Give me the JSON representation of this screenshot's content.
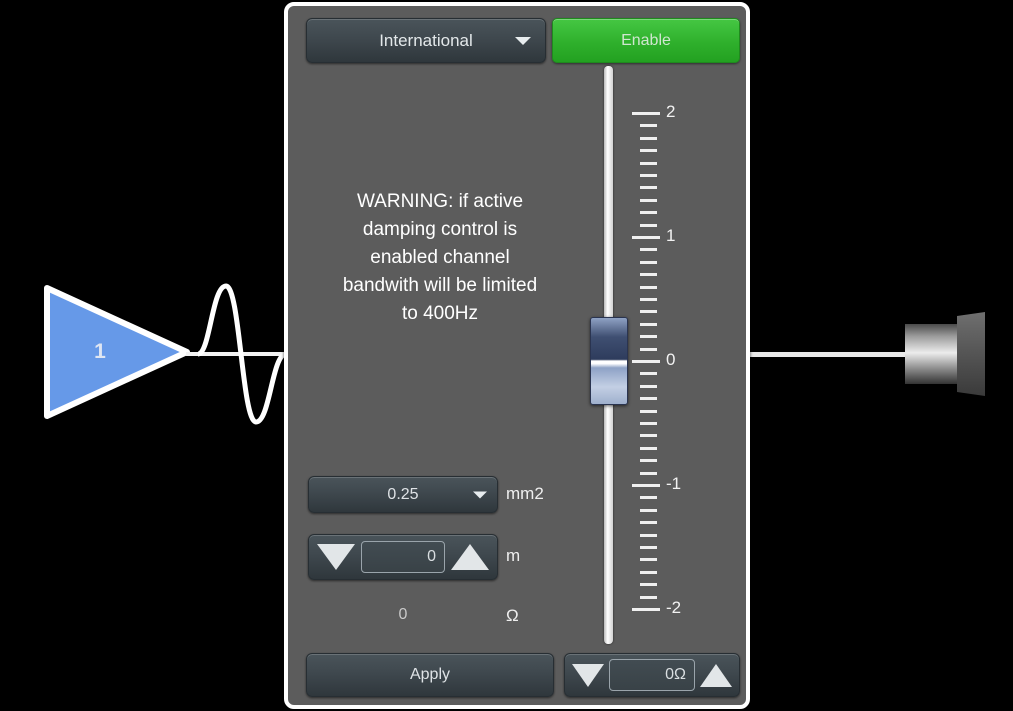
{
  "schematic": {
    "amplifier": {
      "label": "1",
      "icon": "amplifier-triangle-icon",
      "color": "#6699e8"
    },
    "waveform": {
      "icon": "sine-wave-icon"
    },
    "speaker": {
      "icon": "loudspeaker-icon"
    }
  },
  "panel": {
    "standard_select": {
      "value": "International",
      "icon": "chevron-down-icon"
    },
    "enable_button": {
      "label": "Enable",
      "color": "#2fb02c"
    },
    "warning": {
      "lines": [
        "WARNING: if active",
        "damping control is",
        "enabled channel",
        "bandwith will be limited",
        "to 400Hz"
      ]
    },
    "cable_gauge": {
      "value": "0.25",
      "unit": "mm2",
      "icon": "chevron-down-icon"
    },
    "cable_length": {
      "value": "0",
      "unit": "m",
      "decrement_icon": "triangle-down-icon",
      "increment_icon": "triangle-up-icon"
    },
    "resistance": {
      "value": "0",
      "unit": "Ω"
    },
    "apply_button": {
      "label": "Apply"
    },
    "damping_spinner": {
      "value": "0Ω",
      "decrement_icon": "triangle-down-icon",
      "increment_icon": "triangle-up-icon"
    },
    "slider": {
      "value": 0,
      "min": -2,
      "max": 2,
      "major_ticks": [
        {
          "label": "2",
          "value": 2
        },
        {
          "label": "1",
          "value": 1
        },
        {
          "label": "0",
          "value": 0
        },
        {
          "label": "-1",
          "value": -1
        },
        {
          "label": "-2",
          "value": -2
        }
      ],
      "minor_ticks_per_unit": 10
    }
  }
}
